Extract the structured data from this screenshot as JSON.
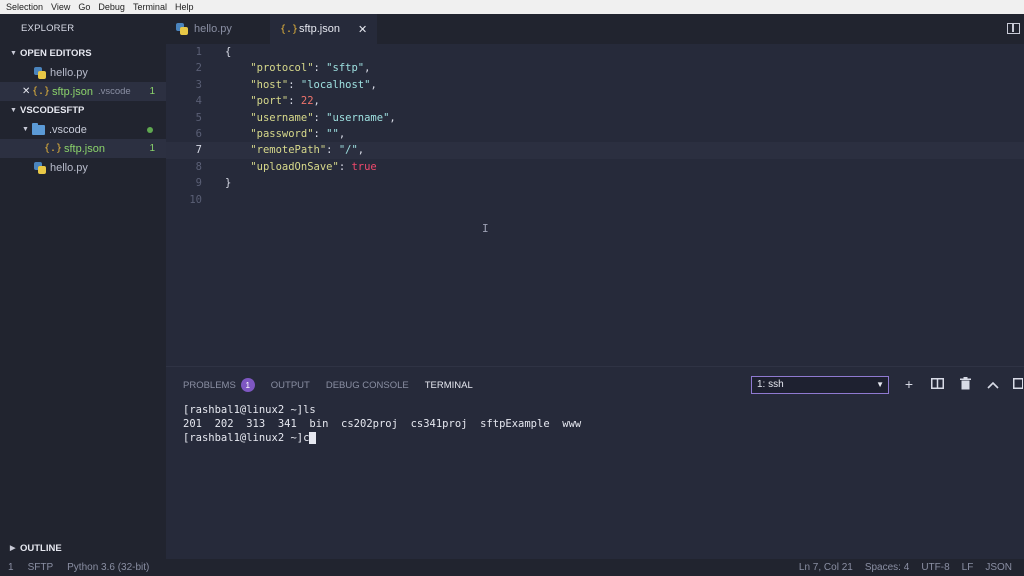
{
  "menu": [
    "Selection",
    "View",
    "Go",
    "Debug",
    "Terminal",
    "Help"
  ],
  "sidebar": {
    "title": "EXPLORER",
    "open_editors": {
      "label": "OPEN EDITORS",
      "items": [
        {
          "name": "hello.py"
        },
        {
          "name": "sftp.json",
          "folder": ".vscode",
          "count": "1"
        }
      ]
    },
    "workspace": {
      "label": "VSCODESFTP",
      "folder": ".vscode",
      "items": [
        {
          "name": "sftp.json",
          "count": "1"
        },
        {
          "name": "hello.py"
        }
      ]
    },
    "outline_label": "OUTLINE"
  },
  "tabs": [
    {
      "label": "hello.py"
    },
    {
      "label": "sftp.json"
    }
  ],
  "editor": {
    "line_numbers": [
      "1",
      "2",
      "3",
      "4",
      "5",
      "6",
      "7",
      "8",
      "9",
      "10"
    ],
    "brace_open": "{",
    "brace_close": "}",
    "entries": [
      {
        "key": "\"protocol\"",
        "value": "\"sftp\"",
        "type": "string"
      },
      {
        "key": "\"host\"",
        "value": "\"localhost\"",
        "type": "string"
      },
      {
        "key": "\"port\"",
        "value": "22",
        "type": "number"
      },
      {
        "key": "\"username\"",
        "value": "\"username\"",
        "type": "string"
      },
      {
        "key": "\"password\"",
        "value": "\"\"",
        "type": "string"
      },
      {
        "key": "\"remotePath\"",
        "value": "\"/\"",
        "type": "string"
      },
      {
        "key": "\"uploadOnSave\"",
        "value": "true",
        "type": "bool"
      }
    ],
    "current_line": 7
  },
  "panel": {
    "tabs": [
      {
        "label": "PROBLEMS",
        "badge": "1"
      },
      {
        "label": "OUTPUT"
      },
      {
        "label": "DEBUG CONSOLE"
      },
      {
        "label": "TERMINAL"
      }
    ],
    "terminal_select": "1: ssh",
    "terminal_lines": [
      "[rashbal1@linux2 ~]ls",
      "201  202  313  341  bin  cs202proj  cs341proj  sftpExample  www",
      "[rashbal1@linux2 ~]c"
    ]
  },
  "status": {
    "left": [
      "1",
      "SFTP",
      "Python 3.6 (32-bit)"
    ],
    "right": [
      "Ln 7, Col 21",
      "Spaces: 4",
      "UTF-8",
      "LF",
      "JSON"
    ]
  },
  "colors": {
    "accent": "#7e57c2",
    "string": "#9ee0e0",
    "key": "#d7d98b",
    "number": "#f0746c",
    "bool": "#f0496c"
  }
}
